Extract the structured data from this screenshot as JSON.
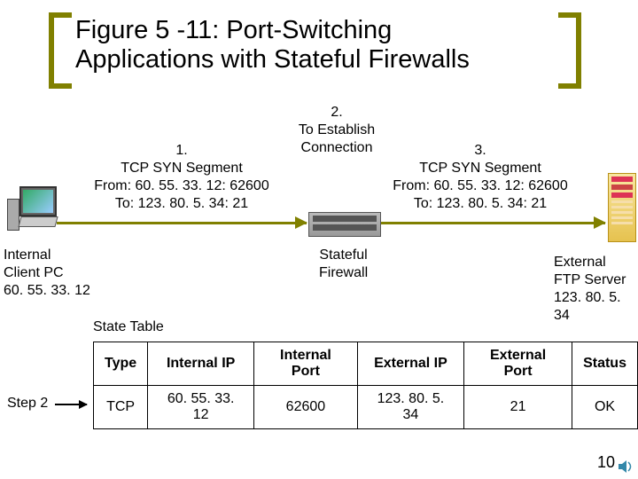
{
  "title_line1": "Figure 5 -11: Port-Switching",
  "title_line2": "Applications with Stateful Firewalls",
  "step2_label": "Step 2",
  "note1": {
    "num": "1.",
    "l1": "TCP SYN Segment",
    "l2": "From: 60. 55. 33. 12: 62600",
    "l3": "To: 123. 80. 5. 34: 21"
  },
  "note2": {
    "num": "2.",
    "l1": "To Establish",
    "l2": "Connection"
  },
  "note3": {
    "num": "3.",
    "l1": "TCP SYN Segment",
    "l2": "From: 60. 55. 33. 12: 62600",
    "l3": "To: 123. 80. 5. 34: 21"
  },
  "pc_label": {
    "l1": "Internal",
    "l2": "Client PC",
    "l3": "60. 55. 33. 12"
  },
  "fw_label": {
    "l1": "Stateful",
    "l2": "Firewall"
  },
  "srv_label": {
    "l1": "External",
    "l2": "FTP Server",
    "l3": "123. 80. 5. 34"
  },
  "state_title": "State Table",
  "table": {
    "headers": [
      "Type",
      "Internal IP",
      "Internal Port",
      "External IP",
      "External Port",
      "Status"
    ],
    "row": [
      "TCP",
      "60. 55. 33. 12",
      "62600",
      "123. 80. 5. 34",
      "21",
      "OK"
    ]
  },
  "page_number": "10"
}
